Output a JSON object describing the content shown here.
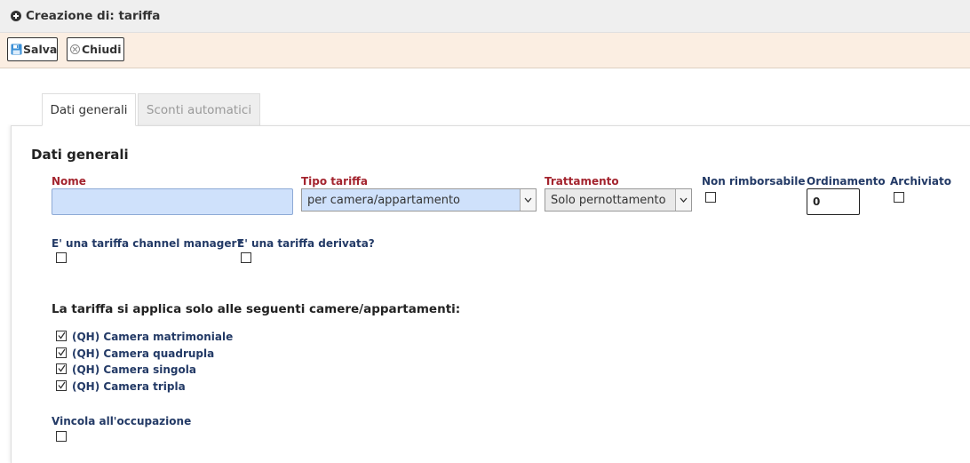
{
  "window": {
    "title": "Creazione di: tariffa"
  },
  "toolbar": {
    "save_label": "Salva",
    "close_label": "Chiudi"
  },
  "tabs": [
    {
      "label": "Dati generali",
      "active": true
    },
    {
      "label": "Sconti automatici",
      "active": false
    }
  ],
  "section": {
    "title": "Dati generali"
  },
  "form": {
    "nome": {
      "label": "Nome",
      "value": ""
    },
    "tipo_tariffa": {
      "label": "Tipo tariffa",
      "selected": "per camera/appartamento"
    },
    "trattamento": {
      "label": "Trattamento",
      "selected": "Solo pernottamento"
    },
    "non_rimborsabile": {
      "label": "Non rimborsabile",
      "checked": false
    },
    "ordinamento": {
      "label": "Ordinamento",
      "value": "0"
    },
    "archiviato": {
      "label": "Archiviato",
      "checked": false
    },
    "channel_manager": {
      "label": "E' una tariffa channel manager?",
      "checked": false
    },
    "derivata": {
      "label": "E' una tariffa derivata?",
      "checked": false
    }
  },
  "rooms": {
    "heading": "La tariffa si applica solo alle seguenti camere/appartamenti:",
    "items": [
      {
        "label": "(QH) Camera matrimoniale",
        "checked": true
      },
      {
        "label": "(QH) Camera quadrupla",
        "checked": true
      },
      {
        "label": "(QH) Camera singola",
        "checked": true
      },
      {
        "label": "(QH) Camera tripla",
        "checked": true
      }
    ]
  },
  "occupancy": {
    "label": "Vincola all'occupazione",
    "checked": false
  },
  "colors": {
    "required_label": "#a3242e",
    "field_label": "#233a66",
    "input_highlight": "#cfe1fb",
    "toolbar_bg": "#fbeee2",
    "save_icon": "#3a8fd6"
  },
  "icons": {
    "title": "plus-circle-icon",
    "save": "floppy-disk-icon",
    "close": "close-circle-icon",
    "select_arrow": "chevron-down-icon",
    "checkbox_checked": "check-icon"
  }
}
